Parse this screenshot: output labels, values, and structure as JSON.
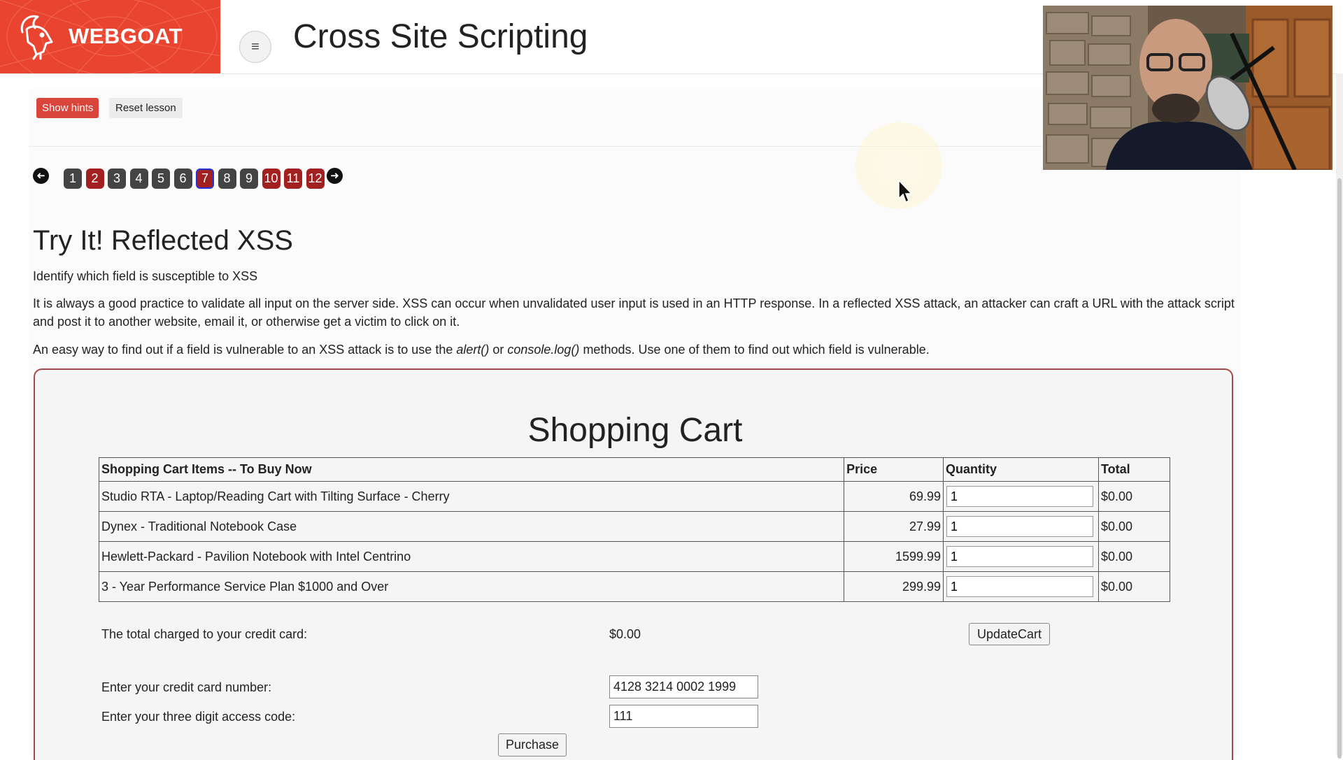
{
  "app": {
    "brand": "WEBGOAT",
    "page_title": "Cross Site Scripting",
    "brand_color": "#e8442f"
  },
  "toolbar": {
    "show_hints": "Show hints",
    "reset_lesson": "Reset lesson"
  },
  "pager": {
    "prev_icon": "arrow-left-icon",
    "next_icon": "arrow-right-icon",
    "current": "7",
    "pages": [
      {
        "label": "1",
        "state": "done"
      },
      {
        "label": "2",
        "state": "todo"
      },
      {
        "label": "3",
        "state": "done"
      },
      {
        "label": "4",
        "state": "done"
      },
      {
        "label": "5",
        "state": "done"
      },
      {
        "label": "6",
        "state": "done"
      },
      {
        "label": "7",
        "state": "current"
      },
      {
        "label": "8",
        "state": "done"
      },
      {
        "label": "9",
        "state": "done"
      },
      {
        "label": "10",
        "state": "todo"
      },
      {
        "label": "11",
        "state": "todo"
      },
      {
        "label": "12",
        "state": "todo"
      }
    ]
  },
  "lesson": {
    "heading": "Try It! Reflected XSS",
    "p1": "Identify which field is susceptible to XSS",
    "p2": "It is always a good practice to validate all input on the server side. XSS can occur when unvalidated user input is used in an HTTP response. In a reflected XSS attack, an attacker can craft a URL with the attack script and post it to another website, email it, or otherwise get a victim to click on it.",
    "p3_before": "An easy way to find out if a field is vulnerable to an XSS attack is to use the ",
    "p3_alert": "alert()",
    "p3_or": " or ",
    "p3_console": "console.log()",
    "p3_after": " methods. Use one of them to find out which field is vulnerable."
  },
  "cart": {
    "title": "Shopping Cart",
    "headers": {
      "items": "Shopping Cart Items -- To Buy Now",
      "price": "Price",
      "quantity": "Quantity",
      "total": "Total"
    },
    "rows": [
      {
        "item": "Studio RTA - Laptop/Reading Cart with Tilting Surface - Cherry",
        "price": "69.99",
        "qty": "1",
        "total": "$0.00"
      },
      {
        "item": "Dynex - Traditional Notebook Case",
        "price": "27.99",
        "qty": "1",
        "total": "$0.00"
      },
      {
        "item": "Hewlett-Packard - Pavilion Notebook with Intel Centrino",
        "price": "1599.99",
        "qty": "1",
        "total": "$0.00"
      },
      {
        "item": "3 - Year Performance Service Plan $1000 and Over",
        "price": "299.99",
        "qty": "1",
        "total": "$0.00"
      }
    ],
    "total_label": "The total charged to your credit card:",
    "total_value": "$0.00",
    "update_button": "UpdateCart",
    "card_label": "Enter your credit card number:",
    "card_value": "4128 3214 0002 1999",
    "code_label": "Enter your three digit access code:",
    "code_value": "111",
    "purchase_button": "Purchase"
  }
}
